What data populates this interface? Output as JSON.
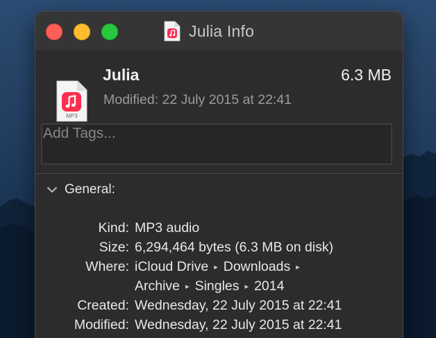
{
  "window": {
    "title": "Julia Info"
  },
  "file": {
    "name": "Julia",
    "size": "6.3 MB",
    "modified": "Modified: 22 July 2015 at 22:41",
    "icon_label": "MP3"
  },
  "tags": {
    "placeholder": "Add Tags..."
  },
  "general": {
    "title": "General:",
    "rows": [
      {
        "label": "Kind:",
        "value": "MP3 audio"
      },
      {
        "label": "Size:",
        "value": "6,294,464 bytes (6.3 MB on disk)"
      },
      {
        "label": "Where:",
        "path": [
          "iCloud Drive",
          "Downloads",
          "Archive",
          "Singles",
          "2014"
        ]
      },
      {
        "label": "Created:",
        "value": "Wednesday, 22 July 2015 at 22:41"
      },
      {
        "label": "Modified:",
        "value": "Wednesday, 22 July 2015 at 22:41"
      }
    ]
  },
  "colors": {
    "close": "#ff5f57",
    "minimize": "#febc2e",
    "zoom": "#28c840",
    "music_icon": "#fb2f4f"
  },
  "icons": {
    "file_type": "music-note-icon",
    "disclosure": "chevron-down-icon",
    "path_separator": "right-triangle-icon"
  }
}
